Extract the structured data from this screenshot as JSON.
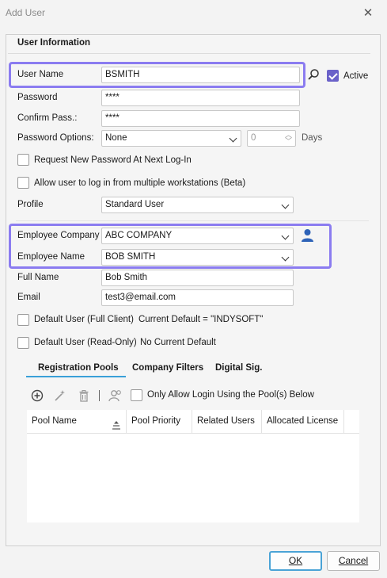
{
  "window": {
    "title": "Add User"
  },
  "group": {
    "title": "User Information"
  },
  "form": {
    "user_name_label": "User Name",
    "user_name_value": "BSMITH",
    "active_label": "Active",
    "password_label": "Password",
    "password_value": "****",
    "confirm_label": "Confirm Pass.:",
    "confirm_value": "****",
    "pwd_options_label": "Password Options:",
    "pwd_options_value": "None",
    "days_value": "0",
    "days_label": "Days",
    "request_new_pwd_label": "Request New Password At Next Log-In",
    "multi_ws_label": "Allow user to log in from multiple workstations (Beta)",
    "profile_label": "Profile",
    "profile_value": "Standard User",
    "emp_company_label": "Employee Company",
    "emp_company_value": "ABC COMPANY",
    "emp_name_label": "Employee Name",
    "emp_name_value": "BOB SMITH",
    "full_name_label": "Full Name",
    "full_name_value": "Bob Smith",
    "email_label": "Email",
    "email_value": "test3@email.com",
    "default_full_label": "Default User (Full Client)",
    "default_full_note": "Current Default = \"INDYSOFT\"",
    "default_ro_label": "Default User (Read-Only)",
    "default_ro_note": "No Current Default"
  },
  "tabs": [
    "Registration Pools",
    "Company Filters",
    "Digital Sig."
  ],
  "pool_toolbar": {
    "only_allow_label": "Only Allow Login Using the Pool(s) Below"
  },
  "pool_table": {
    "columns": [
      "Pool Name",
      "Pool Priority",
      "Related Users",
      "Allocated License"
    ],
    "rows": []
  },
  "buttons": {
    "ok": "OK",
    "cancel": "Cancel"
  },
  "colors": {
    "accent": "#6b62c9",
    "highlight": "#8b7cf0",
    "tab_underline": "#3aa0d8",
    "user_icon": "#2e63b8"
  },
  "icons": [
    "close-icon",
    "search-icon",
    "user-icon",
    "add-icon",
    "wand-icon",
    "trash-icon",
    "users-icon",
    "sort-icon",
    "chevron-down-icon",
    "spinner-icon"
  ]
}
